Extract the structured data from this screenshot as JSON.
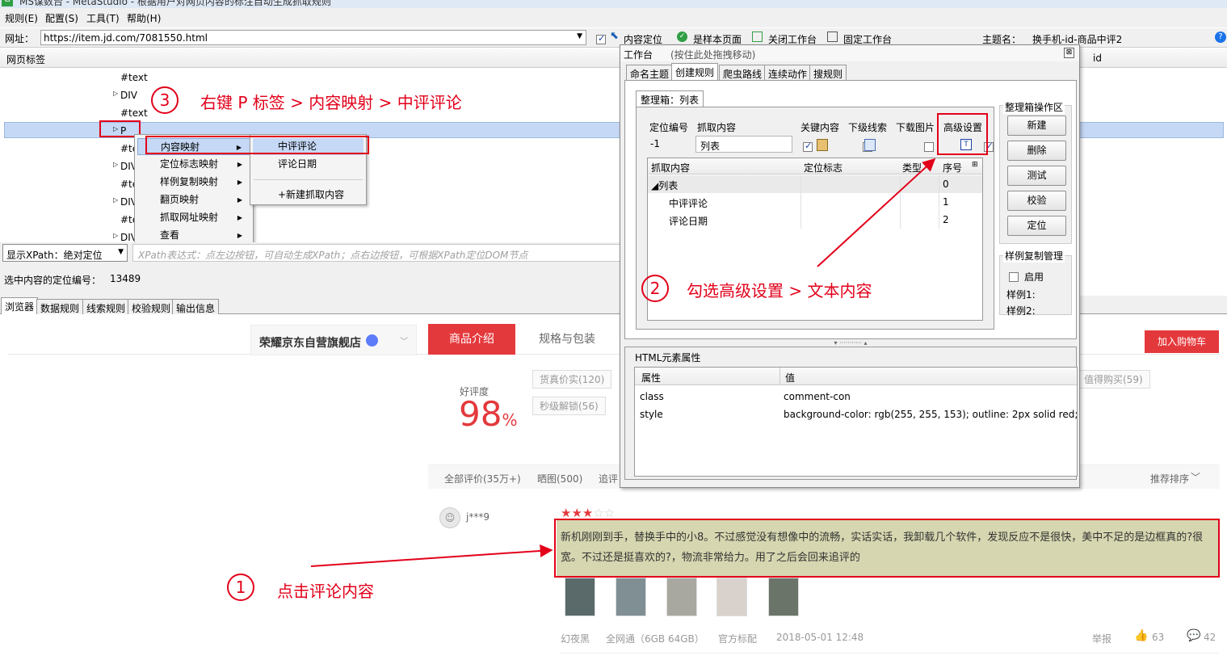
{
  "window": {
    "title": "MS谋数台 - MetaStudio - 根据用户对网页内容的标注自动生成抓取规则"
  },
  "menubar": [
    "规则(E)",
    "配置(S)",
    "工具(T)",
    "帮助(H)"
  ],
  "addressbar": {
    "label": "网址：",
    "url": "https://item.jd.com/7081550.html",
    "opts": [
      "内容定位",
      "是样本页面",
      "关闭工作台",
      "固定工作台"
    ],
    "theme_label": "主题名：",
    "theme_value": "换手机-id-商品中评2"
  },
  "dom_tree": {
    "header": "网页标签",
    "col_id": "id",
    "nodes": [
      "#text",
      "DIV",
      "#text",
      "P",
      "#te",
      "DIV",
      "#te",
      "DIV",
      "#te",
      "DIV"
    ]
  },
  "context_menu": {
    "items": [
      "内容映射",
      "定位标志映射",
      "样例复制映射",
      "翻页映射",
      "抓取网址映射",
      "查看"
    ],
    "submenu": [
      "中评评论",
      "评论日期",
      "+新建抓取内容"
    ]
  },
  "xpath_bar": {
    "mode": "显示XPath：绝对定位",
    "placeholder": "XPath表达式：点左边按钮，可自动生成XPath；点右边按钮，可根据XPath定位DOM节点"
  },
  "selected_locator": {
    "label": "选中内容的定位编号：",
    "value": "13489"
  },
  "bottom_tabs": [
    "浏览器",
    "数据规则",
    "线索规则",
    "校验规则",
    "输出信息"
  ],
  "workbench": {
    "title": "工作台",
    "hint": "(按住此处拖拽移动)",
    "tabs": [
      "命名主题",
      "创建规则",
      "爬虫路线",
      "连续动作",
      "搜规则"
    ],
    "box_tab": "整理箱：列表",
    "fields": {
      "col_locator": "定位编号",
      "col_content": "抓取内容",
      "col_key": "关键内容",
      "col_clue": "下级线索",
      "col_img": "下载图片",
      "col_adv": "高级设置",
      "locator_value": "-1",
      "content_value": "列表"
    },
    "grid": {
      "headers": [
        "抓取内容",
        "定位标志",
        "类型",
        "序号"
      ],
      "rows": [
        {
          "name": "◢列表",
          "seq": "0"
        },
        {
          "name": "中评评论",
          "seq": "1"
        },
        {
          "name": "评论日期",
          "seq": "2"
        }
      ]
    },
    "ops_title": "整理箱操作区",
    "ops": [
      "新建",
      "删除",
      "测试",
      "校验",
      "定位"
    ],
    "sample_title": "样例复制管理",
    "sample_enable": "启用",
    "sample1": "样例1:",
    "sample2": "样例2:",
    "attr_title": "HTML元素属性",
    "attr_headers": [
      "属性",
      "值"
    ],
    "attrs": [
      {
        "name": "class",
        "value": "comment-con"
      },
      {
        "name": "style",
        "value": "background-color: rgb(255, 255, 153); outline: 2px solid red;"
      }
    ]
  },
  "jd_page": {
    "shop": "荣耀京东自营旗舰店",
    "tabs": [
      "商品介绍",
      "规格与包装"
    ],
    "cart": "加入购物车",
    "rate_label": "好评度",
    "rate_value": "98",
    "rate_unit": "%",
    "tags": [
      "货真价实(120)",
      "秒级解锁(56)",
      "值得购买(59)"
    ],
    "filters": [
      "全部评价(35万+)",
      "晒图(500)",
      "追评"
    ],
    "sort": "推荐排序",
    "user": "j***9",
    "comment": "新机刚刚到手，替换手中的小8。不过感觉没有想像中的流畅，实话实话，我卸载几个软件，发现反应不是很快，美中不足的是边框真的?很宽。不过还是挺喜欢的?，物流非常给力。用了之后会回来追评的",
    "meta": [
      "幻夜黑",
      "全网通（6GB 64GB）",
      "官方标配",
      "2018-05-01 12:48"
    ],
    "report": "举报",
    "likes": "63",
    "replies": "42",
    "stars": 3
  },
  "annotations": {
    "step1_num": "1",
    "step1_text": "点击评论内容",
    "step2_num": "2",
    "step2_text": "勾选高级设置 > 文本内容",
    "step3_num": "3",
    "step3_text": "右键 P 标签 > 内容映射 > 中评评论"
  },
  "colors": {
    "accent_red": "#e2001a",
    "jd_red": "#e4393c",
    "highlight": "#ffff99"
  }
}
